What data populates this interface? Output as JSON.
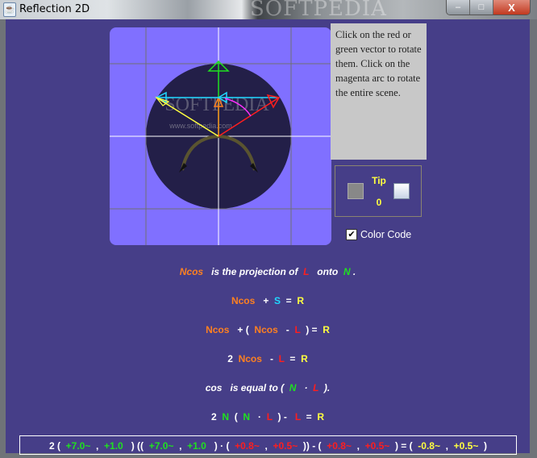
{
  "window": {
    "title": "Reflection 2D",
    "watermark": "SOFTPEDIA",
    "buttons": {
      "minimize": "–",
      "maximize": "□",
      "close": "X"
    }
  },
  "canvas": {
    "watermark": "SOFTPEDIA",
    "watermark_url": "www.softpedia.com",
    "colors": {
      "background": "#8070ff",
      "circle": "#231f48",
      "grid": "#707070",
      "axes": "#ffffff",
      "normal": "#20e020",
      "light": "#ff1e1e",
      "reflection": "#ffff40",
      "projection": "#ff8020",
      "s_vector": "#20d8ff",
      "arc": "#ff30ff"
    }
  },
  "info_text": "Click on the red or green vector to rotate them. Click on the magenta arc to rotate the entire scene.",
  "tip": {
    "label": "Tip",
    "value": "0"
  },
  "color_code": {
    "label": "Color Code",
    "checked": true
  },
  "equations": {
    "line1": {
      "a": "Ncos",
      "b": "   is the projection of  ",
      "c": "L",
      "d": "   onto  ",
      "e": "N",
      "f": " ."
    },
    "line2": {
      "a": "Ncos",
      "b": "   +  ",
      "c": "S",
      "d": "  =  ",
      "e": "R"
    },
    "line3": {
      "a": "Ncos",
      "b": "   + (  ",
      "c": "Ncos",
      "d": "   -  ",
      "e": "L",
      "f": "  ) =  ",
      "g": "R"
    },
    "line4": {
      "a": "2  ",
      "b": "Ncos",
      "c": "   -  ",
      "d": "L",
      "e": "  =  ",
      "f": "R"
    },
    "line5": {
      "a": "cos",
      "b": "   is equal to (  ",
      "c": "N",
      "d": "   ·  ",
      "e": "L",
      "f": "  )."
    },
    "line6": {
      "a": "2  ",
      "b": "N",
      "c": "  (  ",
      "d": "N",
      "e": "   ·  ",
      "f": "L",
      "g": "  ) -   ",
      "h": "L",
      "i": "  =  ",
      "j": "R"
    }
  },
  "result": {
    "p0": "2 (  ",
    "n1": "+7.0~",
    "p1": "  ,  ",
    "n2": "+1.0",
    "p2": "   ) ((  ",
    "n3": "+7.0~",
    "p3": "  ,  ",
    "n4": "+1.0",
    "p4": "   ) · (  ",
    "l1": "+0.8~",
    "p5": "  ,  ",
    "l2": "+0.5~",
    "p6": "  )) - (  ",
    "l3": "+0.8~",
    "p7": "  ,  ",
    "l4": "+0.5~",
    "p8": "  ) = (  ",
    "r1": "-0.8~",
    "p9": "  ,  ",
    "r2": "+0.5~",
    "p10": "  )"
  }
}
